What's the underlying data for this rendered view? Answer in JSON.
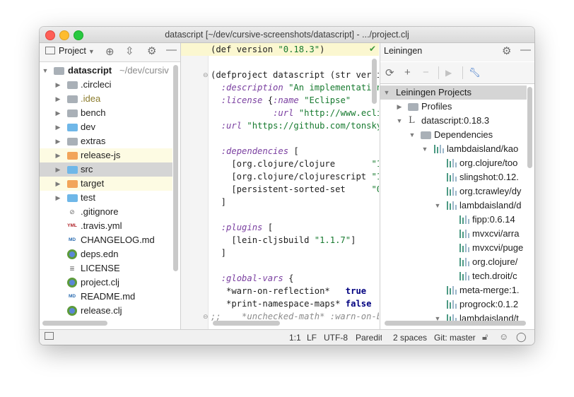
{
  "window": {
    "title": "datascript [~/dev/cursive-screenshots/datascript] - .../project.clj"
  },
  "project_panel": {
    "title": "Project",
    "root": {
      "name": "datascript",
      "path": "~/dev/cursiv"
    },
    "items": [
      {
        "label": ".circleci",
        "kind": "folder",
        "color": "gray"
      },
      {
        "label": ".idea",
        "kind": "folder",
        "color": "gray"
      },
      {
        "label": "bench",
        "kind": "folder",
        "color": "gray"
      },
      {
        "label": "dev",
        "kind": "folder",
        "color": "blue"
      },
      {
        "label": "extras",
        "kind": "folder",
        "color": "gray"
      },
      {
        "label": "release-js",
        "kind": "folder",
        "color": "orange"
      },
      {
        "label": "src",
        "kind": "folder",
        "color": "blue"
      },
      {
        "label": "target",
        "kind": "folder",
        "color": "orange"
      },
      {
        "label": "test",
        "kind": "folder",
        "color": "blue"
      },
      {
        "label": ".gitignore",
        "kind": "file"
      },
      {
        "label": ".travis.yml",
        "kind": "yml"
      },
      {
        "label": "CHANGELOG.md",
        "kind": "md"
      },
      {
        "label": "deps.edn",
        "kind": "clj"
      },
      {
        "label": "LICENSE",
        "kind": "doc"
      },
      {
        "label": "project.clj",
        "kind": "clj"
      },
      {
        "label": "README.md",
        "kind": "md"
      },
      {
        "label": "release.clj",
        "kind": "clj"
      }
    ]
  },
  "editor": {
    "lines": [
      [
        "(def version ",
        "\"0.18.3\"",
        ")"
      ],
      [
        ""
      ],
      [
        "(defproject datascript (str versio"
      ],
      [
        "  ",
        ":description",
        " ",
        "\"An implementation"
      ],
      [
        "  ",
        ":license",
        " {",
        ":name",
        " ",
        "\"Eclipse\""
      ],
      [
        "            ",
        ":url",
        " ",
        "\"http://www.eclip"
      ],
      [
        "  ",
        ":url",
        " ",
        "\"https://github.com/tonsky/"
      ],
      [
        ""
      ],
      [
        "  ",
        ":dependencies",
        " ["
      ],
      [
        "    [org.clojure/clojure       ",
        "\"1."
      ],
      [
        "    [org.clojure/clojurescript ",
        "\"1."
      ],
      [
        "    [persistent-sorted-set     ",
        "\"0."
      ],
      [
        "  ]"
      ],
      [
        ""
      ],
      [
        "  ",
        ":plugins",
        " ["
      ],
      [
        "    [lein-cljsbuild ",
        "\"1.1.7\"",
        "]"
      ],
      [
        "  ]"
      ],
      [
        ""
      ],
      [
        "  ",
        ":global-vars",
        " {"
      ],
      [
        "   *warn-on-reflection*   ",
        "true"
      ],
      [
        "   *print-namespace-maps* ",
        "false"
      ],
      [
        ";;    *unchecked-math* :warn-on-b"
      ]
    ]
  },
  "leiningen": {
    "title": "Leiningen",
    "projects_label": "Leiningen Projects",
    "profiles_label": "Profiles",
    "project_label": "datascript:0.18.3",
    "dependencies_label": "Dependencies",
    "deps": [
      {
        "label": "lambdaisland/kao",
        "level": 0,
        "expand": "open"
      },
      {
        "label": "org.clojure/too",
        "level": 1
      },
      {
        "label": "slingshot:0.12.",
        "level": 1
      },
      {
        "label": "org.tcrawley/dy",
        "level": 1
      },
      {
        "label": "lambdaisland/d",
        "level": 1,
        "expand": "open"
      },
      {
        "label": "fipp:0.6.14",
        "level": 2
      },
      {
        "label": "mvxcvi/arra",
        "level": 2
      },
      {
        "label": "mvxcvi/puge",
        "level": 2
      },
      {
        "label": "org.clojure/",
        "level": 2
      },
      {
        "label": "tech.droit/c",
        "level": 2
      },
      {
        "label": "meta-merge:1.",
        "level": 1
      },
      {
        "label": "progrock:0.1.2",
        "level": 1
      },
      {
        "label": "lambdaisland/t",
        "level": 1,
        "expand": "open"
      }
    ]
  },
  "status_bar": {
    "position": "1:1",
    "line_sep": "LF",
    "encoding": "UTF-8",
    "paredit": "Paredit",
    "indent": "2 spaces",
    "git": "Git: master"
  }
}
